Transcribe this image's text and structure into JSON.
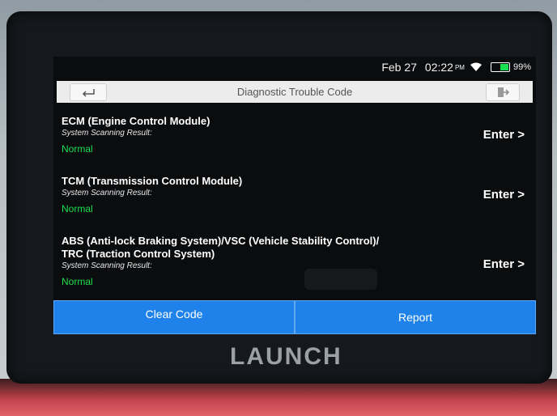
{
  "status": {
    "date": "Feb 27",
    "time": "02:22",
    "ampm": "PM",
    "battery": "99%",
    "battery_level": 0.99
  },
  "header": {
    "title": "Diagnostic Trouble Code"
  },
  "modules": [
    {
      "name": "ECM (Engine Control Module)",
      "scan_label": "System Scanning Result:",
      "result": "Normal",
      "action": "Enter >"
    },
    {
      "name": "TCM (Transmission Control Module)",
      "scan_label": "System Scanning Result:",
      "result": "Normal",
      "action": "Enter >"
    },
    {
      "name_line1": "ABS (Anti-lock Braking System)/VSC (Vehicle Stability Control)/",
      "name_line2": "TRC (Traction Control System)",
      "scan_label": "System Scanning Result:",
      "result": "Normal",
      "action": "Enter >"
    }
  ],
  "footer": {
    "clear_label": "Clear Code",
    "report_label": "Report"
  },
  "brand": "LAUNCH",
  "colors": {
    "accent": "#1f82ea",
    "normal": "#19e04f"
  },
  "icons": [
    "back-arrow-icon",
    "exit-icon",
    "wifi-icon",
    "battery-icon"
  ]
}
